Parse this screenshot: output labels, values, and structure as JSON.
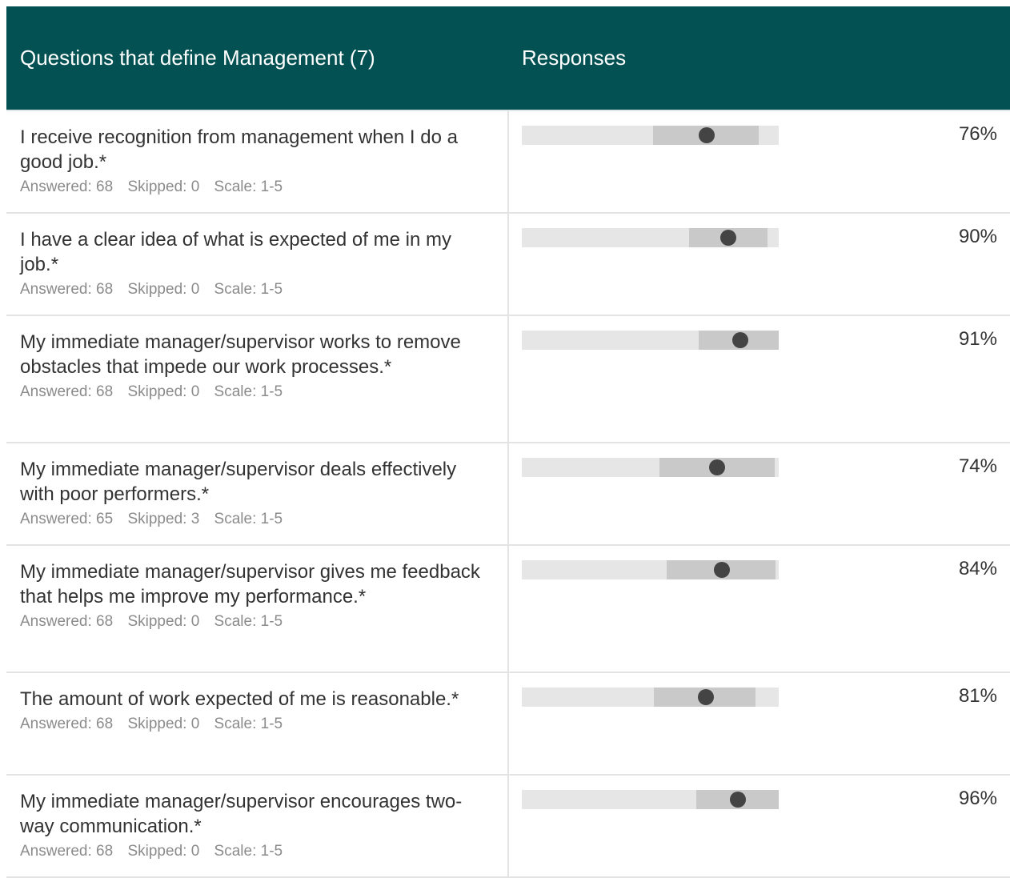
{
  "header": {
    "questions_label": "Questions that define Management (7)",
    "responses_label": "Responses"
  },
  "rows": [
    {
      "question": "I receive recognition from management when I do a good job.*",
      "answered": "Answered: 68",
      "skipped": "Skipped: 0",
      "scale": "Scale: 1-5",
      "percent": "76%",
      "range_low": 0.51,
      "range_high": 0.92,
      "marker": 0.72
    },
    {
      "question": "I have a clear idea of what is expected of me in my job.*",
      "answered": "Answered: 68",
      "skipped": "Skipped: 0",
      "scale": "Scale: 1-5",
      "percent": "90%",
      "range_low": 0.65,
      "range_high": 0.955,
      "marker": 0.805
    },
    {
      "question": "My immediate manager/supervisor works to remove obstacles that impede our work processes.*",
      "answered": "Answered: 68",
      "skipped": "Skipped: 0",
      "scale": "Scale: 1-5",
      "percent": "91%",
      "range_low": 0.69,
      "range_high": 1.0,
      "marker": 0.85
    },
    {
      "question": "My immediate manager/supervisor deals effectively with poor performers.*",
      "answered": "Answered: 65",
      "skipped": "Skipped: 3",
      "scale": "Scale: 1-5",
      "percent": "74%",
      "range_low": 0.535,
      "range_high": 0.985,
      "marker": 0.76
    },
    {
      "question": "My immediate manager/supervisor gives me feedback that helps me improve my performance.*",
      "answered": "Answered: 68",
      "skipped": "Skipped: 0",
      "scale": "Scale: 1-5",
      "percent": "84%",
      "range_low": 0.565,
      "range_high": 0.99,
      "marker": 0.78
    },
    {
      "question": "The amount of work expected of me is reasonable.*",
      "answered": "Answered: 68",
      "skipped": "Skipped: 0",
      "scale": "Scale: 1-5",
      "percent": "81%",
      "range_low": 0.515,
      "range_high": 0.91,
      "marker": 0.715
    },
    {
      "question": "My immediate manager/supervisor encourages two-way communication.*",
      "answered": "Answered: 68",
      "skipped": "Skipped: 0",
      "scale": "Scale: 1-5",
      "percent": "96%",
      "range_low": 0.68,
      "range_high": 1.0,
      "marker": 0.84
    }
  ],
  "colors": {
    "header_bg": "#035153",
    "track": "#e6e6e6",
    "range": "#c9c9c9",
    "marker": "#444444",
    "meta_text": "#8b8b8b"
  }
}
